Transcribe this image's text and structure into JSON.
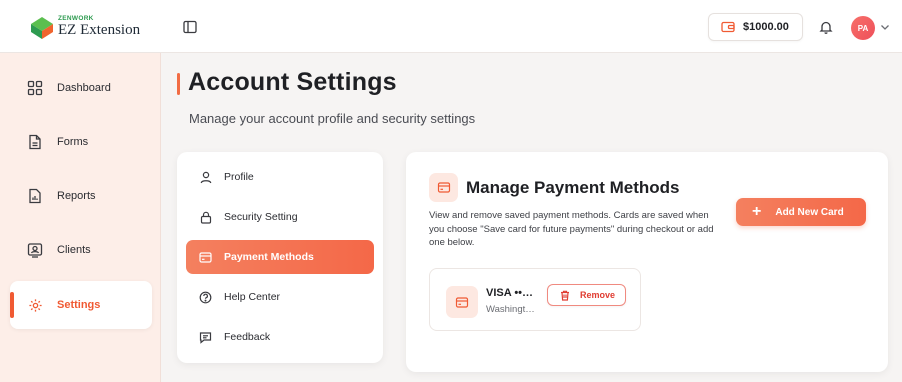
{
  "brand": {
    "small": "ZENWORK",
    "name": "EZ Extension"
  },
  "sidebar": {
    "items": [
      {
        "label": "Dashboard",
        "icon": "grid-icon"
      },
      {
        "label": "Forms",
        "icon": "document-icon"
      },
      {
        "label": "Reports",
        "icon": "report-icon"
      },
      {
        "label": "Clients",
        "icon": "contact-card-icon"
      },
      {
        "label": "Settings",
        "icon": "gear-icon",
        "active": true
      }
    ]
  },
  "header": {
    "balance": "$1000.00",
    "avatar_initials": "PA"
  },
  "page": {
    "title": "Account Settings",
    "subtitle": "Manage your account profile and security settings"
  },
  "settings_menu": {
    "items": [
      {
        "label": "Profile",
        "icon": "user-icon"
      },
      {
        "label": "Security Setting",
        "icon": "lock-icon"
      },
      {
        "label": "Payment Methods",
        "icon": "credit-card-icon",
        "active": true
      },
      {
        "label": "Help Center",
        "icon": "help-circle-icon"
      },
      {
        "label": "Feedback",
        "icon": "chat-icon"
      }
    ]
  },
  "payment": {
    "title": "Manage Payment Methods",
    "description": "View and remove saved payment methods. Cards are saved when you choose \"Save card for future payments\" during checkout or add one below.",
    "add_button": "Add New Card",
    "cards": [
      {
        "brand": "VISA ••…",
        "location": "Washingt…",
        "remove_label": "Remove"
      }
    ]
  },
  "colors": {
    "accent": "#f05a33",
    "sidebar_bg": "#fdeee8",
    "brand_green": "#2e9b50"
  }
}
